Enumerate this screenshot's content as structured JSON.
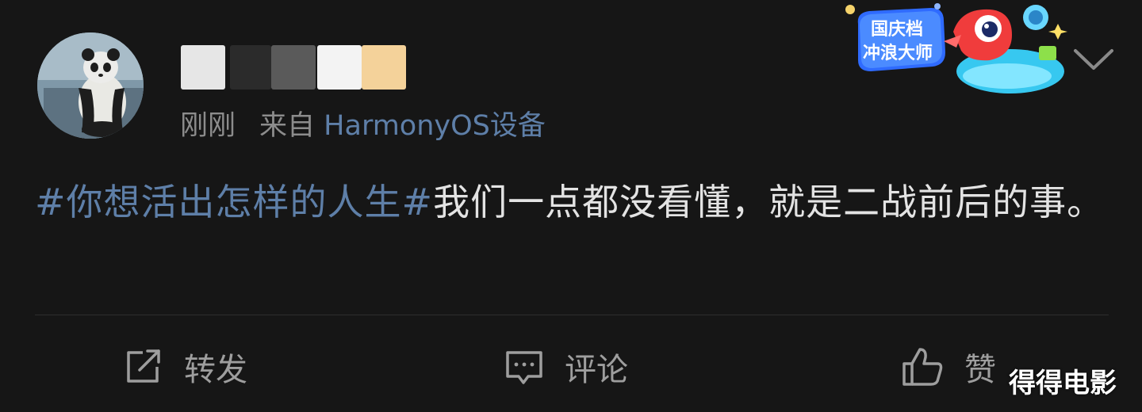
{
  "post": {
    "timestamp": "刚刚",
    "source_prefix": "来自",
    "source_device": "HarmonyOS设备",
    "hashtag": "#你想活出怎样的人生#",
    "body_text": "我们一点都没看懂，就是二战前后的事。"
  },
  "badge": {
    "line1": "国庆档",
    "line2": "冲浪大师"
  },
  "actions": {
    "repost": "转发",
    "comment": "评论",
    "like": "赞"
  },
  "watermark": "得得电影",
  "colors": {
    "background": "#161616",
    "link": "#5e7fa8",
    "body_text": "#e3e3e3",
    "secondary_text": "#8c8c8c"
  }
}
